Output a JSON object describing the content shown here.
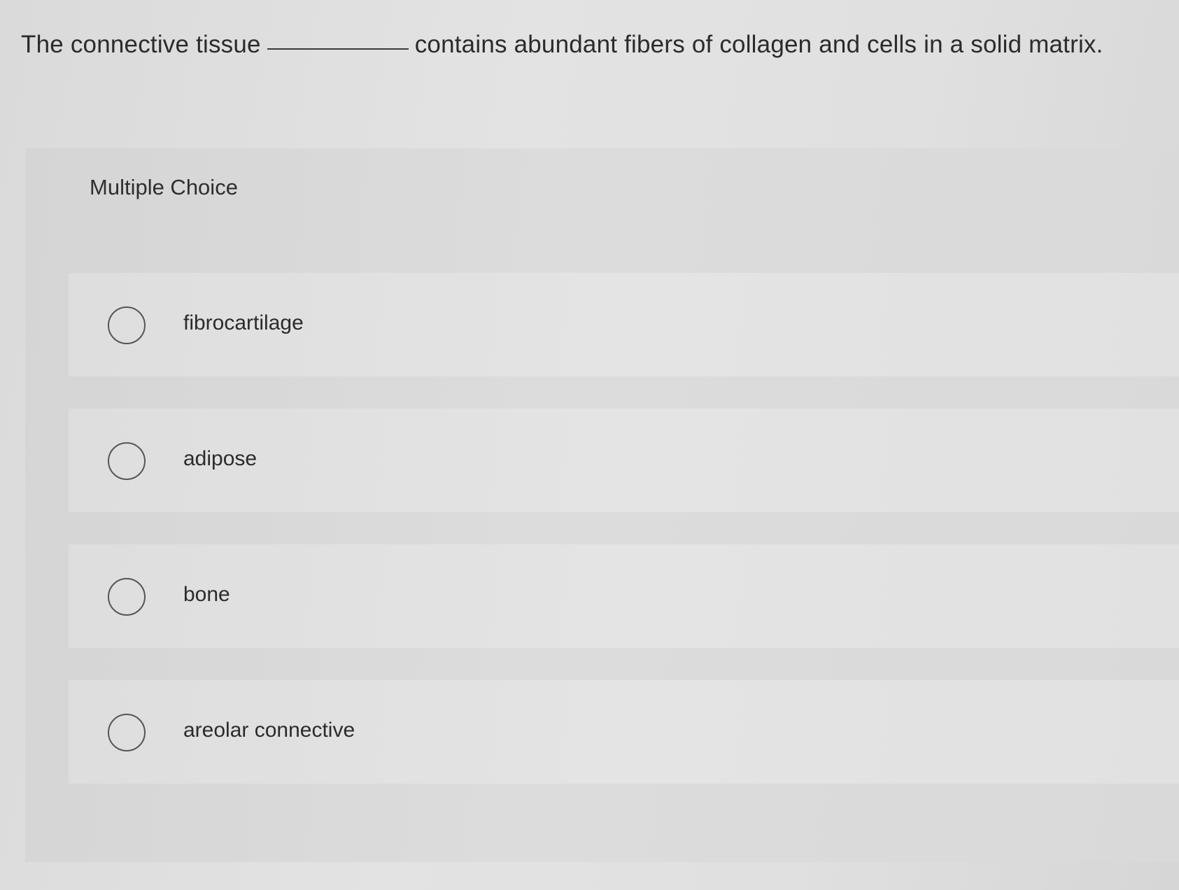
{
  "question": {
    "before_blank": "The connective tissue",
    "after_blank": "contains abundant fibers of collagen and cells in a solid matrix."
  },
  "multiple_choice": {
    "heading": "Multiple Choice",
    "options": [
      {
        "label": "fibrocartilage",
        "selected": false
      },
      {
        "label": "adipose",
        "selected": false
      },
      {
        "label": "bone",
        "selected": false
      },
      {
        "label": "areolar connective",
        "selected": false
      }
    ]
  }
}
